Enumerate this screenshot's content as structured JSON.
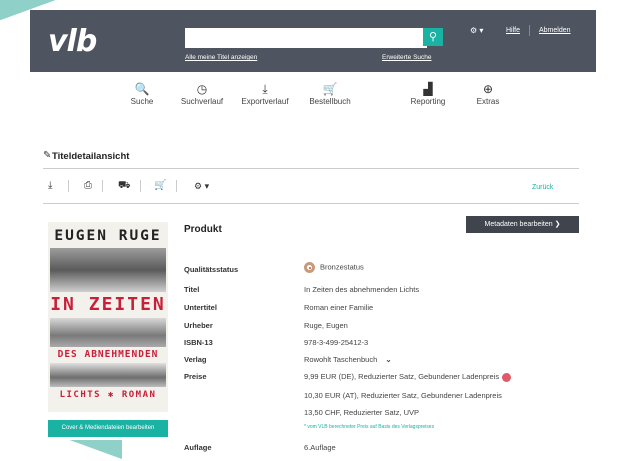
{
  "header": {
    "logo": "vlb",
    "search_placeholder": "",
    "search_icon": "search-icon",
    "link_my_titles": "Alle meine Titel anzeigen",
    "link_advanced": "Erweiterte Suche",
    "gear_menu": "⚙ ▾",
    "help": "Hilfe",
    "logout": "Abmelden"
  },
  "toolbar": [
    {
      "icon": "search-icon",
      "glyph": "🔍",
      "label": "Suche"
    },
    {
      "icon": "history-icon",
      "glyph": "◷",
      "label": "Suchverlauf"
    },
    {
      "icon": "export-icon",
      "glyph": "⤓",
      "label": "Exportverlauf"
    },
    {
      "icon": "cart-icon",
      "glyph": "🛒",
      "label": "Bestellbuch"
    },
    {
      "icon": "reporting-icon",
      "glyph": "▟",
      "label": "Reporting"
    },
    {
      "icon": "extras-icon",
      "glyph": "⊕",
      "label": "Extras"
    }
  ],
  "section": {
    "title": "Titeldetailansicht",
    "back": "Zurück"
  },
  "cover": {
    "author": "EUGEN RUGE",
    "title_1": "IN ZEITEN",
    "title_2": "DES ABNEHMENDEN",
    "title_3": "LICHTS ✱ ROMAN",
    "button": "Cover & Mediendateien bearbeiten"
  },
  "product": {
    "title": "Produkt",
    "edit_button": "Metadaten bearbeiten  ❯",
    "quality_label": "Qualitätsstatus",
    "quality_value": "Bronzestatus",
    "titel_label": "Titel",
    "titel_value": "In Zeiten des abnehmenden Lichts",
    "untertitel_label": "Untertitel",
    "untertitel_value": "Roman einer Familie",
    "urheber_label": "Urheber",
    "urheber_value": "Ruge, Eugen",
    "isbn_label": "ISBN-13",
    "isbn_value": "978-3-499-25412-3",
    "verlag_label": "Verlag",
    "verlag_value": "Rowohlt Taschenbuch",
    "preise_label": "Preise",
    "preis_1": "9,99 EUR (DE), Reduzierter Satz, Gebundener Ladenpreis",
    "preis_2": "10,30 EUR (AT), Reduzierter Satz, Gebundener Ladenpreis",
    "preis_3": "13,50 CHF, Reduzierter Satz, UVP",
    "preis_note": "* vom VLB berechneter Preis auf Basis des Verlagspreises",
    "auflage_label": "Auflage",
    "auflage_value": "6.Auflage"
  },
  "colors": {
    "accent": "#19b2a3",
    "header": "#4f5560",
    "cover_red": "#c8203a"
  }
}
